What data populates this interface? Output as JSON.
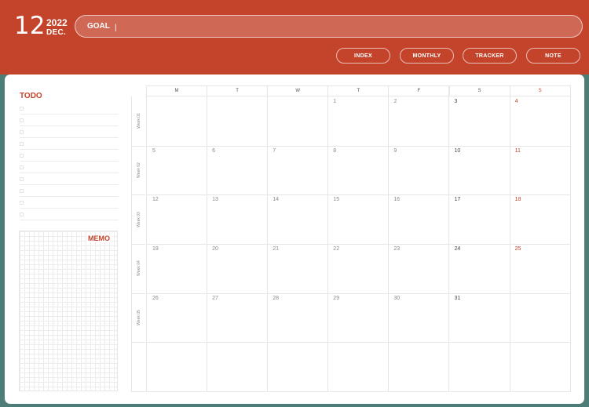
{
  "header": {
    "month_number": "12",
    "year": "2022",
    "month_name": "DEC.",
    "goal_label": "GOAL",
    "goal_value": "|",
    "nav": [
      {
        "label": "INDEX",
        "name": "nav-index-button"
      },
      {
        "label": "MONTHLY",
        "name": "nav-monthly-button"
      },
      {
        "label": "TRACKER",
        "name": "nav-tracker-button"
      },
      {
        "label": "NOTE",
        "name": "nav-note-button"
      }
    ]
  },
  "todo": {
    "title": "TODO",
    "line_count": 10
  },
  "memo": {
    "title": "MEMO"
  },
  "calendar": {
    "day_headers": [
      "M",
      "T",
      "W",
      "T",
      "F",
      "S",
      "S"
    ],
    "sunday_color": "#c4432b",
    "week_labels": [
      "Week 01",
      "Week 02",
      "Week 03",
      "Week 04",
      "Week 05",
      ""
    ],
    "weeks": [
      [
        "",
        "",
        "",
        "1",
        "2",
        "3",
        "4"
      ],
      [
        "5",
        "6",
        "7",
        "8",
        "9",
        "10",
        "11"
      ],
      [
        "12",
        "13",
        "14",
        "15",
        "16",
        "17",
        "18"
      ],
      [
        "19",
        "20",
        "21",
        "22",
        "23",
        "24",
        "25"
      ],
      [
        "26",
        "27",
        "28",
        "29",
        "30",
        "31",
        ""
      ],
      [
        "",
        "",
        "",
        "",
        "",
        "",
        ""
      ]
    ]
  }
}
